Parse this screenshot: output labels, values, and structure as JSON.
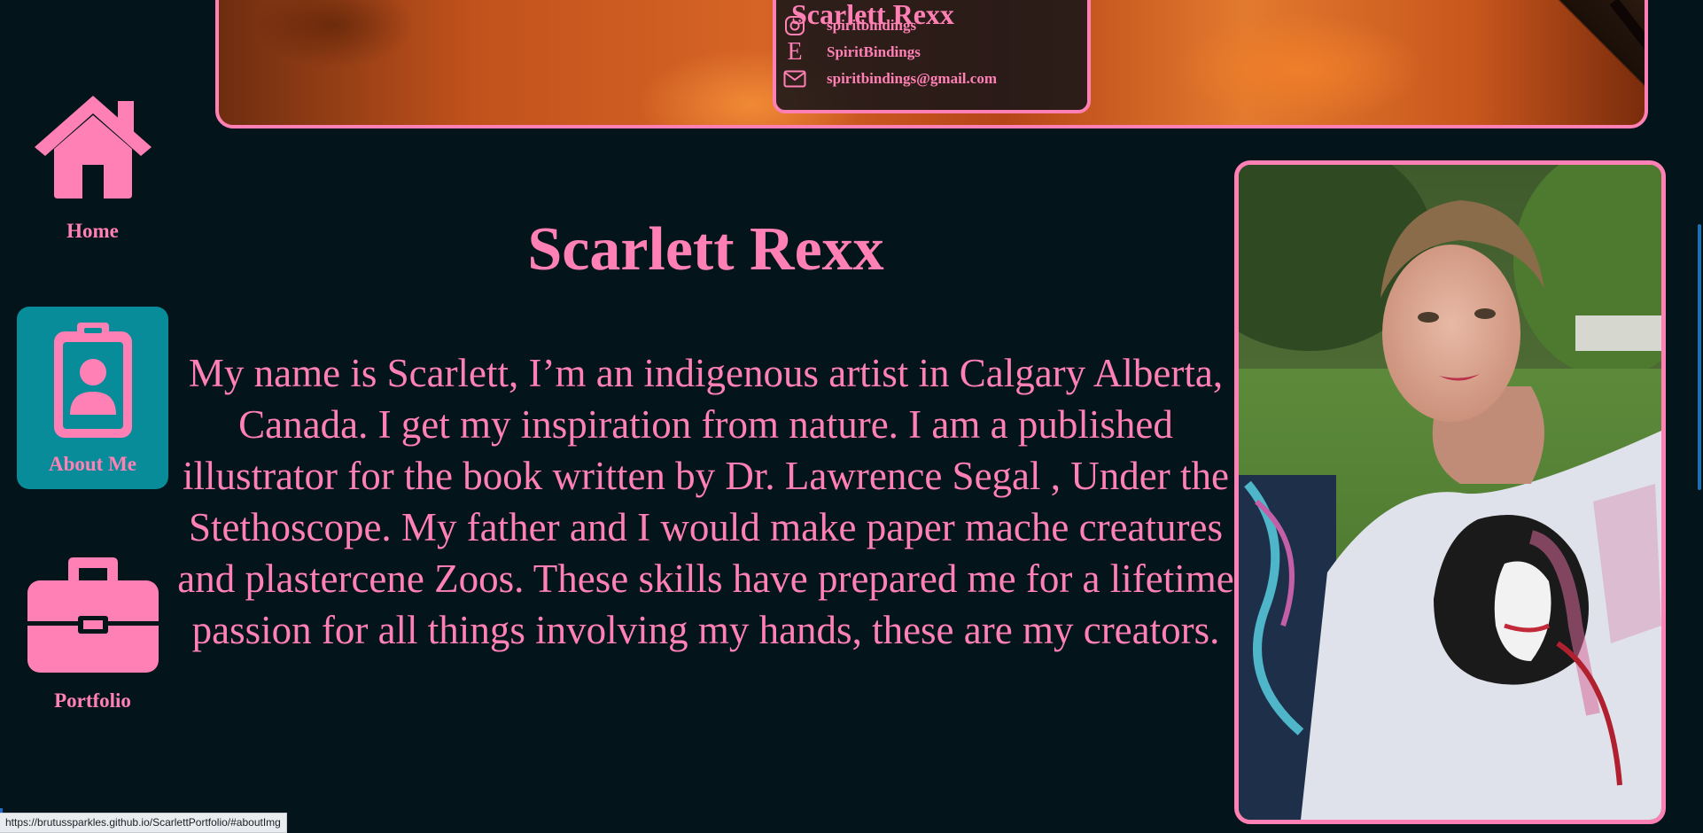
{
  "contact_card": {
    "name": "Scarlett Rexx",
    "instagram": {
      "icon": "instagram-icon",
      "label": "spiritbindings"
    },
    "etsy": {
      "icon": "etsy-icon",
      "glyph": "E",
      "label": "SpiritBindings"
    },
    "email": {
      "icon": "envelope-icon",
      "label": "spiritbindings@gmail.com"
    }
  },
  "sidebar": {
    "items": [
      {
        "label": "Home",
        "icon": "home-icon",
        "active": false
      },
      {
        "label": "About Me",
        "icon": "id-badge-icon",
        "active": true
      },
      {
        "label": "Portfolio",
        "icon": "briefcase-icon",
        "active": false
      }
    ]
  },
  "main": {
    "title": "Scarlett Rexx",
    "bio": "My name is Scarlett, I’m an indigenous artist in Calgary Alberta, Canada. I get my inspiration from nature. I am a published illustrator for the book written by Dr. Lawrence Segal , Under the Stethoscope. My father and I would make paper mache creatures and plastercene Zoos. These skills have prepared me for a lifetime passion for all things involving my hands, these are my creators."
  },
  "status_bar": {
    "url": "https://brutussparkles.github.io/ScarlettPortfolio/#aboutImg"
  },
  "colors": {
    "background": "#04141b",
    "accent_pink": "#ff80b5",
    "active_nav_bg": "#098c9a"
  }
}
